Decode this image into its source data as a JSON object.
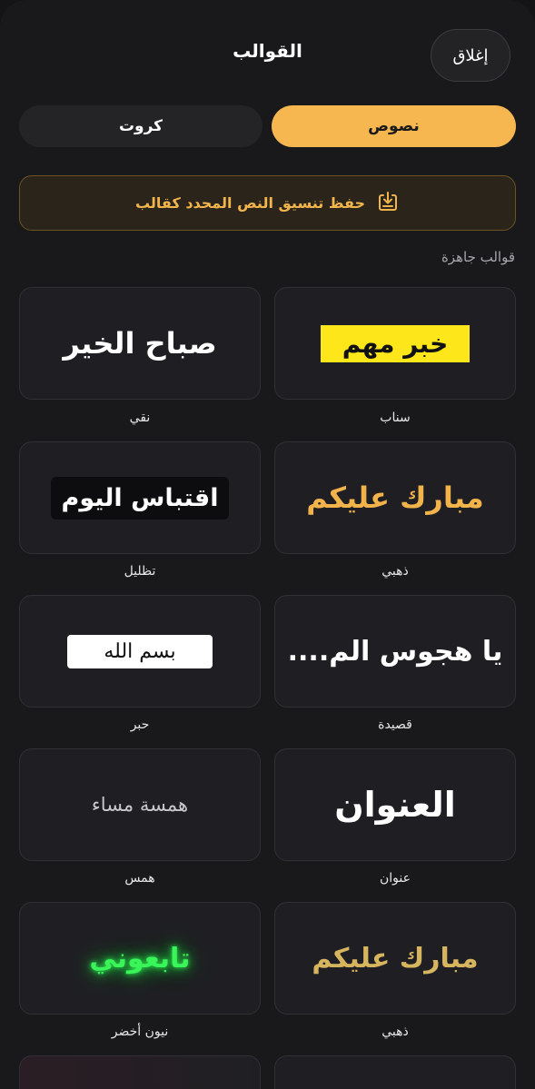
{
  "header": {
    "title": "القوالب",
    "close_label": "إغلاق"
  },
  "tabs": {
    "texts_label": "نصوص",
    "cards_label": "كروت",
    "active": "texts"
  },
  "save_template": {
    "label": "حفظ تنسيق النص المحدد كقالب",
    "icon": "download-box-icon"
  },
  "section": {
    "ready_templates_label": "قوالب جاهزة"
  },
  "templates": [
    {
      "name": "سناب",
      "preview": "خبر مهم"
    },
    {
      "name": "نقي",
      "preview": "صباح الخير"
    },
    {
      "name": "ذهبي",
      "preview": "مبارك عليكم"
    },
    {
      "name": "تظليل",
      "preview": "اقتباس اليوم"
    },
    {
      "name": "قصيدة",
      "preview": "يا هجوس الم...."
    },
    {
      "name": "حبر",
      "preview": "بسم الله"
    },
    {
      "name": "عنوان",
      "preview": "العنوان"
    },
    {
      "name": "همس",
      "preview": "همسة مساء"
    },
    {
      "name": "ذهبي",
      "preview": "مبارك عليكم"
    },
    {
      "name": "نيون أخضر",
      "preview": "تابعوني"
    }
  ],
  "colors": {
    "accent": "#f6b751",
    "background": "#19191c",
    "card": "#1f1f23",
    "neon_green": "#39f55a",
    "snap_yellow": "#fde619"
  }
}
